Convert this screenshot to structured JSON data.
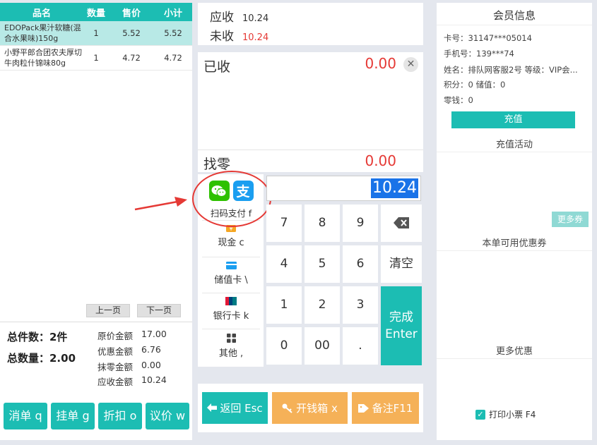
{
  "table": {
    "headers": [
      "品名",
      "数量",
      "售价",
      "小计"
    ],
    "rows": [
      {
        "name": "EDOPack果汁软糖(混合水果味)150g",
        "qty": "1",
        "price": "5.52",
        "subtotal": "5.52"
      },
      {
        "name": "小野平郎合团农夫厚切牛肉粒什锦味80g",
        "qty": "1",
        "price": "4.72",
        "subtotal": "4.72"
      }
    ],
    "prev_page": "上一页",
    "next_page": "下一页"
  },
  "summary": {
    "total_items": "总件数：2件",
    "total_qty": "总数量：2.00",
    "original_label": "原价金额",
    "original_value": "17.00",
    "discount_label": "优惠金额",
    "discount_value": "6.76",
    "rounding_label": "抹零金额",
    "rounding_value": "0.00",
    "due_label": "应收金额",
    "due_value": "10.24"
  },
  "bottom_buttons": [
    "消单 q",
    "挂单 g",
    "折扣 o",
    "议价 w"
  ],
  "due": {
    "receivable_label": "应收",
    "receivable_value": "10.24",
    "unpaid_label": "未收",
    "unpaid_value": "10.24"
  },
  "paid": {
    "label": "已收",
    "value": "0.00",
    "close": "✕"
  },
  "change": {
    "label": "找零",
    "value": "0.00"
  },
  "payment_methods": {
    "scan": "扫码支付 f",
    "cash": "现金 c",
    "stored_card": "储值卡 \\",
    "bank_card": "银行卡 k",
    "other": "其他 ,",
    "alipay_glyph": "支"
  },
  "amount_input": "10.24",
  "keypad": {
    "k7": "7",
    "k8": "8",
    "k9": "9",
    "k4": "4",
    "k5": "5",
    "k6": "6",
    "clear": "清空",
    "k1": "1",
    "k2": "2",
    "k3": "3",
    "k0": "0",
    "k00": "00",
    "dot": ".",
    "done_line1": "完成",
    "done_line2": "Enter"
  },
  "actions": {
    "back": "返回 Esc",
    "cash_drawer": "开钱箱 x",
    "note": "备注F11"
  },
  "member": {
    "title": "会员信息",
    "card_no": "卡号：31147***05014",
    "phone": "手机号：139***74",
    "name_level": "姓名：排队网客服2号    等级：VIP会...",
    "points_balance": "积分：0  储值：0",
    "change": "零钱：0",
    "recharge_button": "充值",
    "recharge_activity": "充值活动",
    "more_coupons": "更多券",
    "available_coupons": "本单可用优惠券",
    "more_discounts": "更多优惠",
    "print_receipt": "打印小票 F4"
  },
  "colors": {
    "teal": "#1cbdb3",
    "orange": "#f5b158",
    "red": "#e53935",
    "selection_blue": "#1a73e8"
  }
}
